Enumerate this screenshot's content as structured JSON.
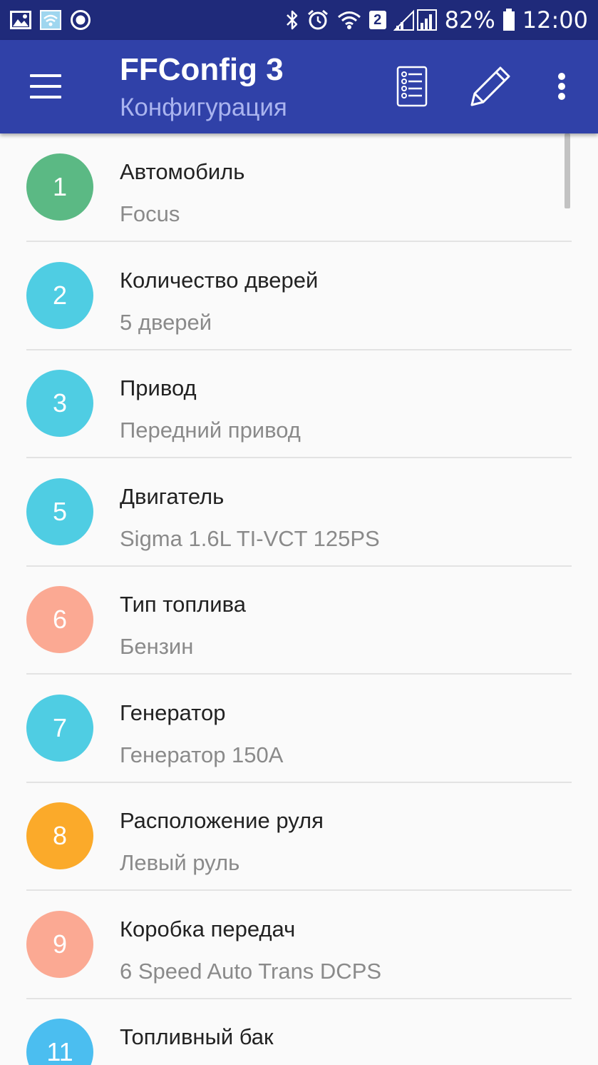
{
  "status_bar": {
    "battery_pct": "82%",
    "time": "12:00",
    "sim_badge": "2",
    "icons": [
      "image-icon",
      "wifi-file-icon",
      "record-icon",
      "bluetooth-icon",
      "alarm-icon",
      "wifi-icon",
      "signal-icon",
      "battery-icon"
    ]
  },
  "app_bar": {
    "title": "FFConfig 3",
    "subtitle": "Конфигурация",
    "icons": [
      "menu-icon",
      "checklist-icon",
      "pencil-icon",
      "more-vert-icon"
    ]
  },
  "colors": {
    "status_bar": "#1f2a7a",
    "app_bar": "#3041a8",
    "green": "#5bb984",
    "cyan": "#4fcde3",
    "salmon": "#fba993",
    "orange": "#fbaa2a",
    "blue": "#4bbef0"
  },
  "items": [
    {
      "number": "1",
      "title": "Автомобиль",
      "value": "Focus",
      "color": "#5bb984"
    },
    {
      "number": "2",
      "title": "Количество дверей",
      "value": "5 дверей",
      "color": "#4fcde3"
    },
    {
      "number": "3",
      "title": "Привод",
      "value": "Передний привод",
      "color": "#4fcde3"
    },
    {
      "number": "5",
      "title": "Двигатель",
      "value": "Sigma 1.6L TI-VCT 125PS",
      "color": "#4fcde3"
    },
    {
      "number": "6",
      "title": "Тип топлива",
      "value": "Бензин",
      "color": "#fba993"
    },
    {
      "number": "7",
      "title": "Генератор",
      "value": "Генератор 150A",
      "color": "#4fcde3"
    },
    {
      "number": "8",
      "title": "Расположение руля",
      "value": "Левый руль",
      "color": "#fbaa2a"
    },
    {
      "number": "9",
      "title": "Коробка передач",
      "value": "6 Speed Auto Trans DCPS",
      "color": "#fba993"
    },
    {
      "number": "11",
      "title": "Топливный бак",
      "value": "",
      "color": "#4bbef0"
    }
  ]
}
